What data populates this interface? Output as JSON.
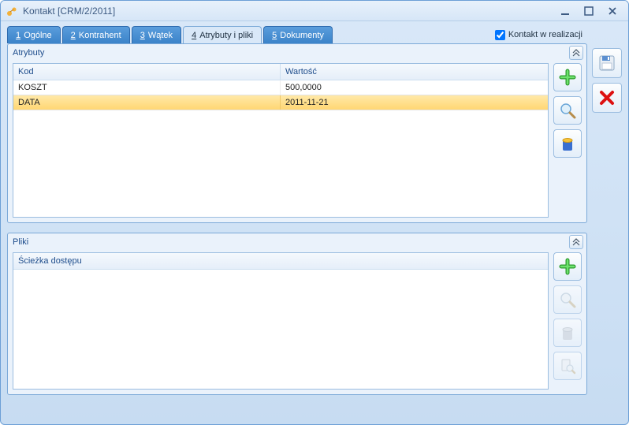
{
  "window": {
    "title": "Kontakt [CRM/2/2011]"
  },
  "checkbox": {
    "label": "Kontakt w realizacji",
    "checked": true
  },
  "tabs": [
    {
      "num": "1",
      "label": "Ogólne"
    },
    {
      "num": "2",
      "label": "Kontrahent"
    },
    {
      "num": "3",
      "label": "Wątek"
    },
    {
      "num": "4",
      "label": "Atrybuty i pliki"
    },
    {
      "num": "5",
      "label": "Dokumenty"
    }
  ],
  "attrs": {
    "legend": "Atrybuty",
    "cols": {
      "c1": "Kod",
      "c2": "Wartość"
    },
    "rows": [
      {
        "kod": "KOSZT",
        "wartosc": "500,0000"
      },
      {
        "kod": "DATA",
        "wartosc": "2011-11-21"
      }
    ]
  },
  "files": {
    "legend": "Pliki",
    "cols": {
      "c1": "Ścieżka dostępu"
    }
  }
}
